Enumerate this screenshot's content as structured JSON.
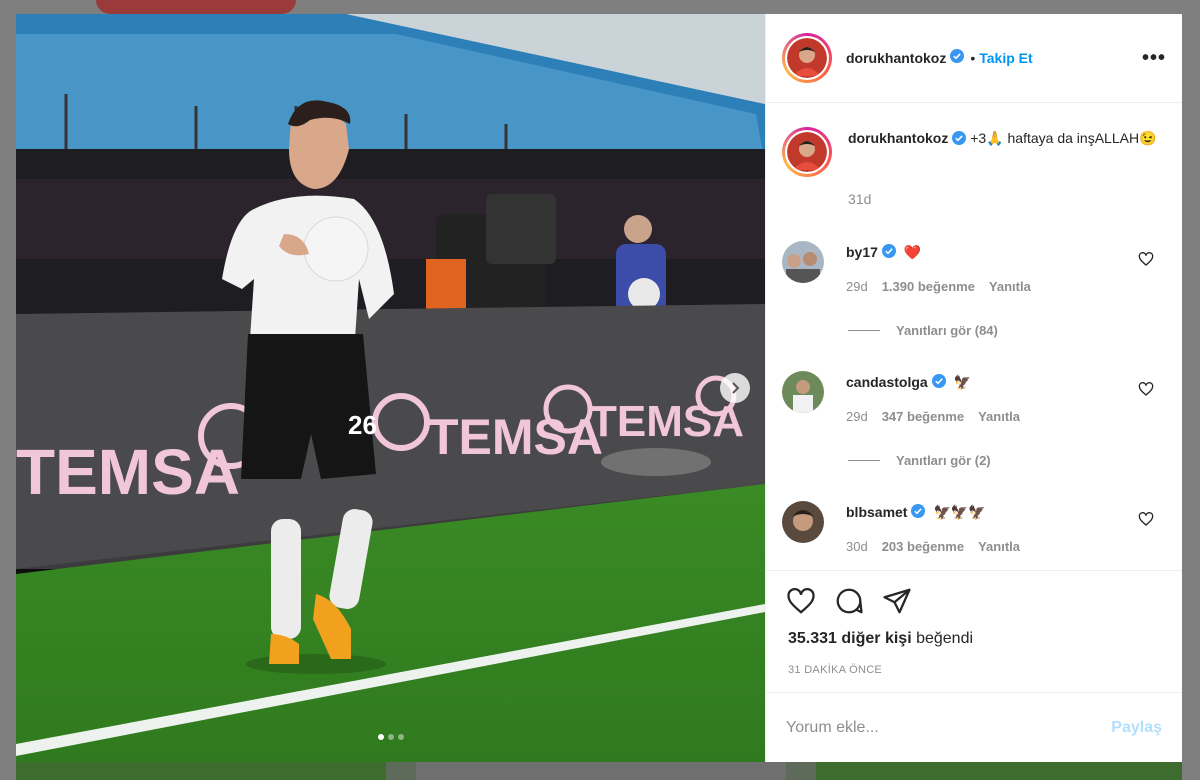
{
  "post": {
    "username": "dorukhantokoz",
    "follow_separator": "•",
    "follow_label": "Takip Et",
    "more_label": "•••",
    "caption_text": "+3🙏 haftaya da inşALLAH😉",
    "caption_time": "31d",
    "photo_index": 1,
    "photo_count": 3,
    "photo_text": {
      "jersey_number": "26",
      "board_left": "TEMSA",
      "board_mid": "TEMSA",
      "board_right": "TEMSA"
    }
  },
  "comments": [
    {
      "username": "by17",
      "text": "❤️",
      "age": "29d",
      "likes": "1.390 beğenme",
      "reply_label": "Yanıtla",
      "view_replies": "Yanıtları gör (84)"
    },
    {
      "username": "candastolga",
      "text": "🦅",
      "age": "29d",
      "likes": "347 beğenme",
      "reply_label": "Yanıtla",
      "view_replies": "Yanıtları gör (2)"
    },
    {
      "username": "blbsamet",
      "text": "🦅🦅🦅",
      "age": "30d",
      "likes": "203 beğenme",
      "reply_label": "Yanıtla"
    }
  ],
  "engagement": {
    "likes_count": "35.331 diğer kişi",
    "likes_suffix": " beğendi",
    "time_ago": "31 DAKİKA ÖNCE"
  },
  "comment_input": {
    "placeholder": "Yorum ekle...",
    "post_label": "Paylaş"
  },
  "icons": {
    "like": "heart-icon",
    "comment": "comment-icon",
    "share": "paper-plane-icon",
    "next": "chevron-right-icon",
    "verified": "verified-badge-icon"
  },
  "colors": {
    "link_blue": "#0095f6",
    "verified_blue": "#3897f0",
    "muted_text": "#8e8e8e",
    "post_disabled": "#b2dffc",
    "pitch_green": "#3d8f2a"
  }
}
